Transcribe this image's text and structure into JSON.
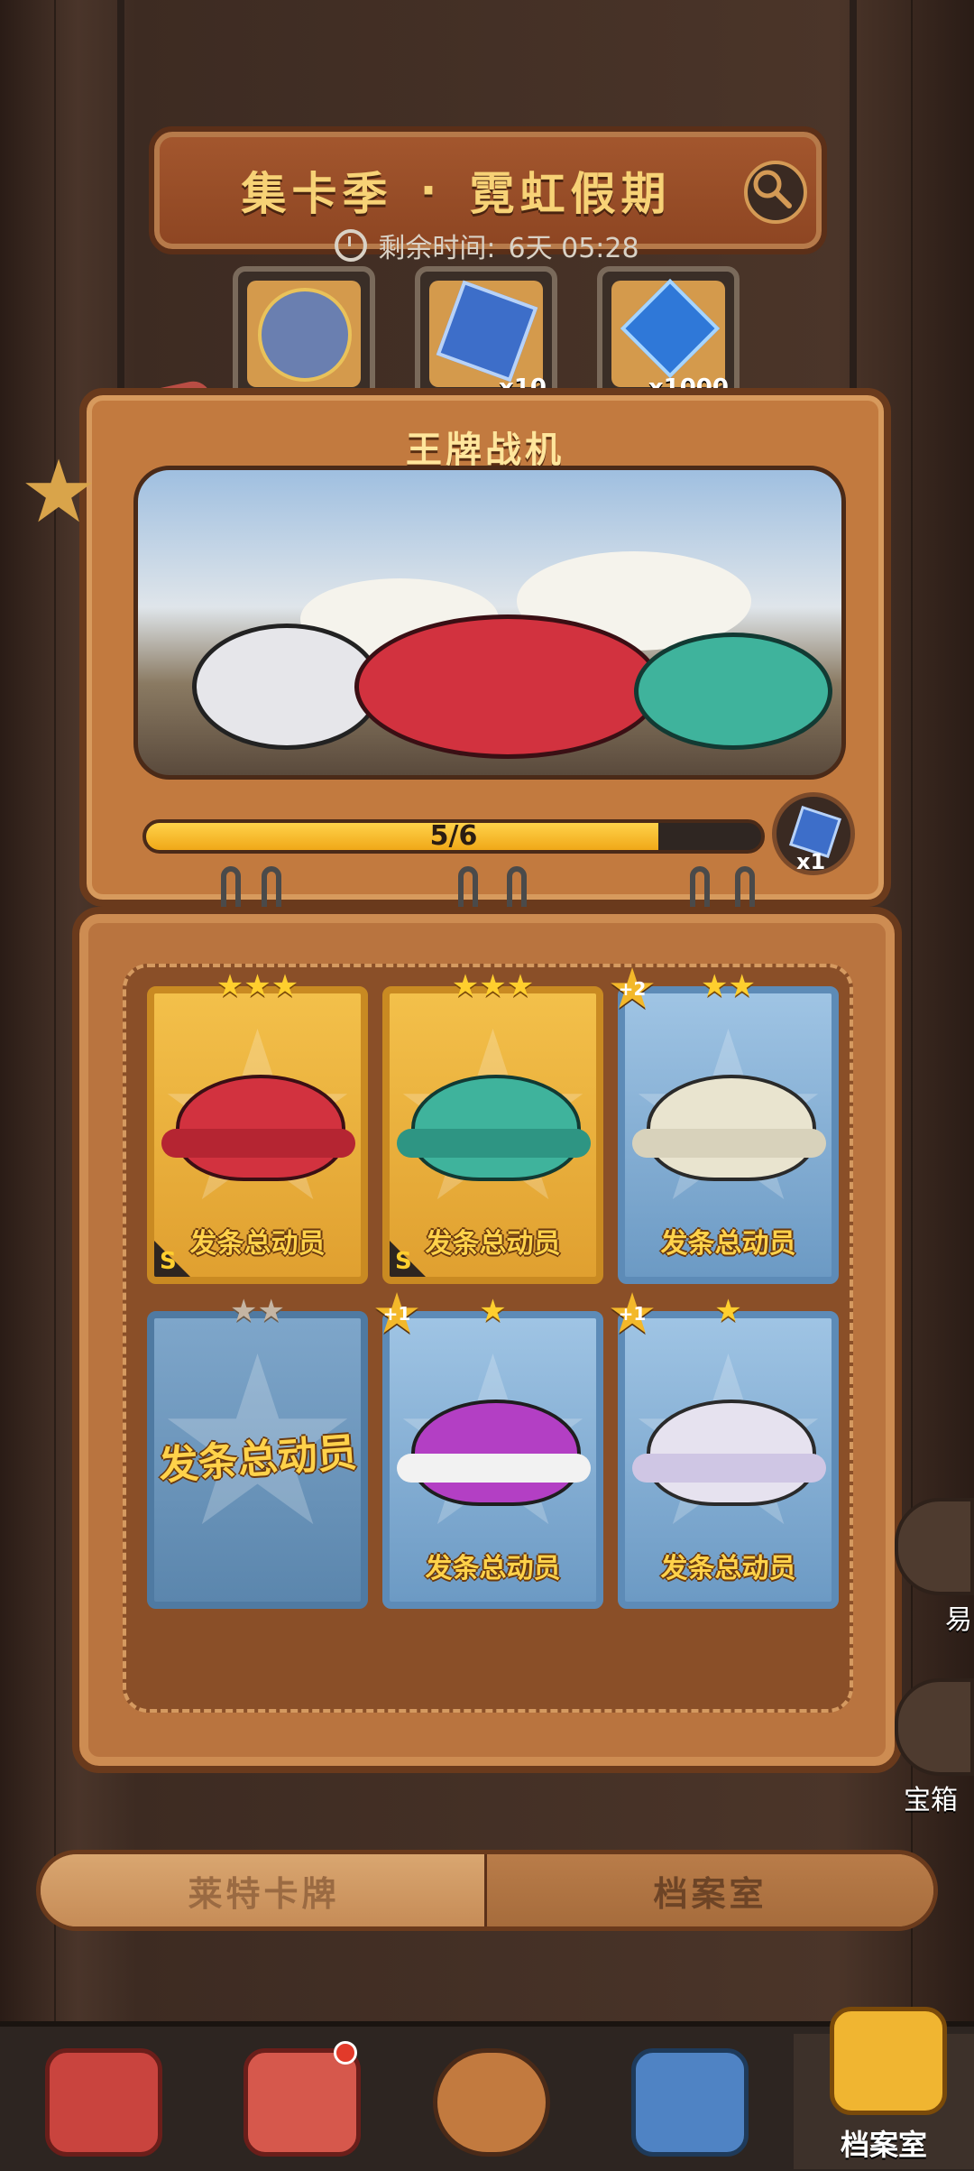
{
  "header": {
    "title_left": "集卡季",
    "title_dot": "·",
    "title_right": "霓虹假期",
    "timer_label": "剩余时间:",
    "timer_value": "6天 05:28"
  },
  "rewards": [
    {
      "name": "avatar-reward",
      "count": ""
    },
    {
      "name": "cube-reward",
      "count": "x10"
    },
    {
      "name": "gem-reward",
      "count": "x1000"
    }
  ],
  "collection": {
    "title": "王牌战机",
    "progress_text": "5/6",
    "progress_fraction": 0.833,
    "reward_count": "x1"
  },
  "cards": [
    {
      "type": "gold",
      "stars": "★★★",
      "rank": "S",
      "brand": "发条总动员",
      "color": "#d2323f"
    },
    {
      "type": "gold",
      "stars": "★★★",
      "rank": "S",
      "brand": "发条总动员",
      "color": "#3fb39c"
    },
    {
      "type": "blue",
      "stars": "★★",
      "plus": "+2",
      "brand": "发条总动员",
      "color": "#e9e4cf"
    },
    {
      "type": "back",
      "stars": "★★",
      "brand": "发条总动员"
    },
    {
      "type": "blue",
      "stars": "★",
      "plus": "+1",
      "brand": "发条总动员",
      "color": "#b33fc4"
    },
    {
      "type": "blue",
      "stars": "★",
      "plus": "+1",
      "brand": "发条总动员",
      "color": "#e6e2ef"
    }
  ],
  "side": {
    "partial_label_1": "易",
    "label_2": "宝箱"
  },
  "tabs": {
    "left": "莱特卡牌",
    "right": "档案室"
  },
  "nav": {
    "active_label": "档案室"
  },
  "colors": {
    "accent_gold": "#f7d276",
    "progress": "#ffcf2e"
  }
}
